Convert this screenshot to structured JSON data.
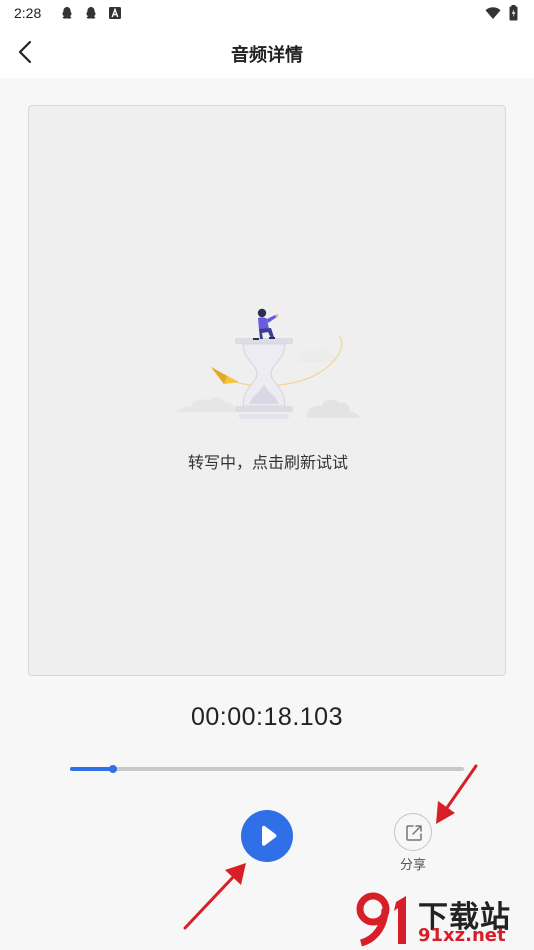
{
  "statusbar": {
    "time": "2:28",
    "notifications": [
      "qq-icon",
      "qq-icon",
      "a-icon"
    ],
    "icons": [
      "wifi-icon",
      "battery-icon"
    ]
  },
  "appbar": {
    "title": "音频详情",
    "back_icon": "back-arrow-icon"
  },
  "content": {
    "status_text": "转写中，点击刷新试试",
    "illustration": "hourglass-person-illustration"
  },
  "player": {
    "time": "00:00:18.103",
    "progress_fraction": 0.11,
    "play_icon": "play-icon",
    "share_label": "分享",
    "share_icon": "share-icon"
  },
  "colors": {
    "accent": "#2f6fe8",
    "annotation_arrow": "#d71f27"
  },
  "watermark": {
    "top": "下载站",
    "bottom": "91xz.net"
  }
}
